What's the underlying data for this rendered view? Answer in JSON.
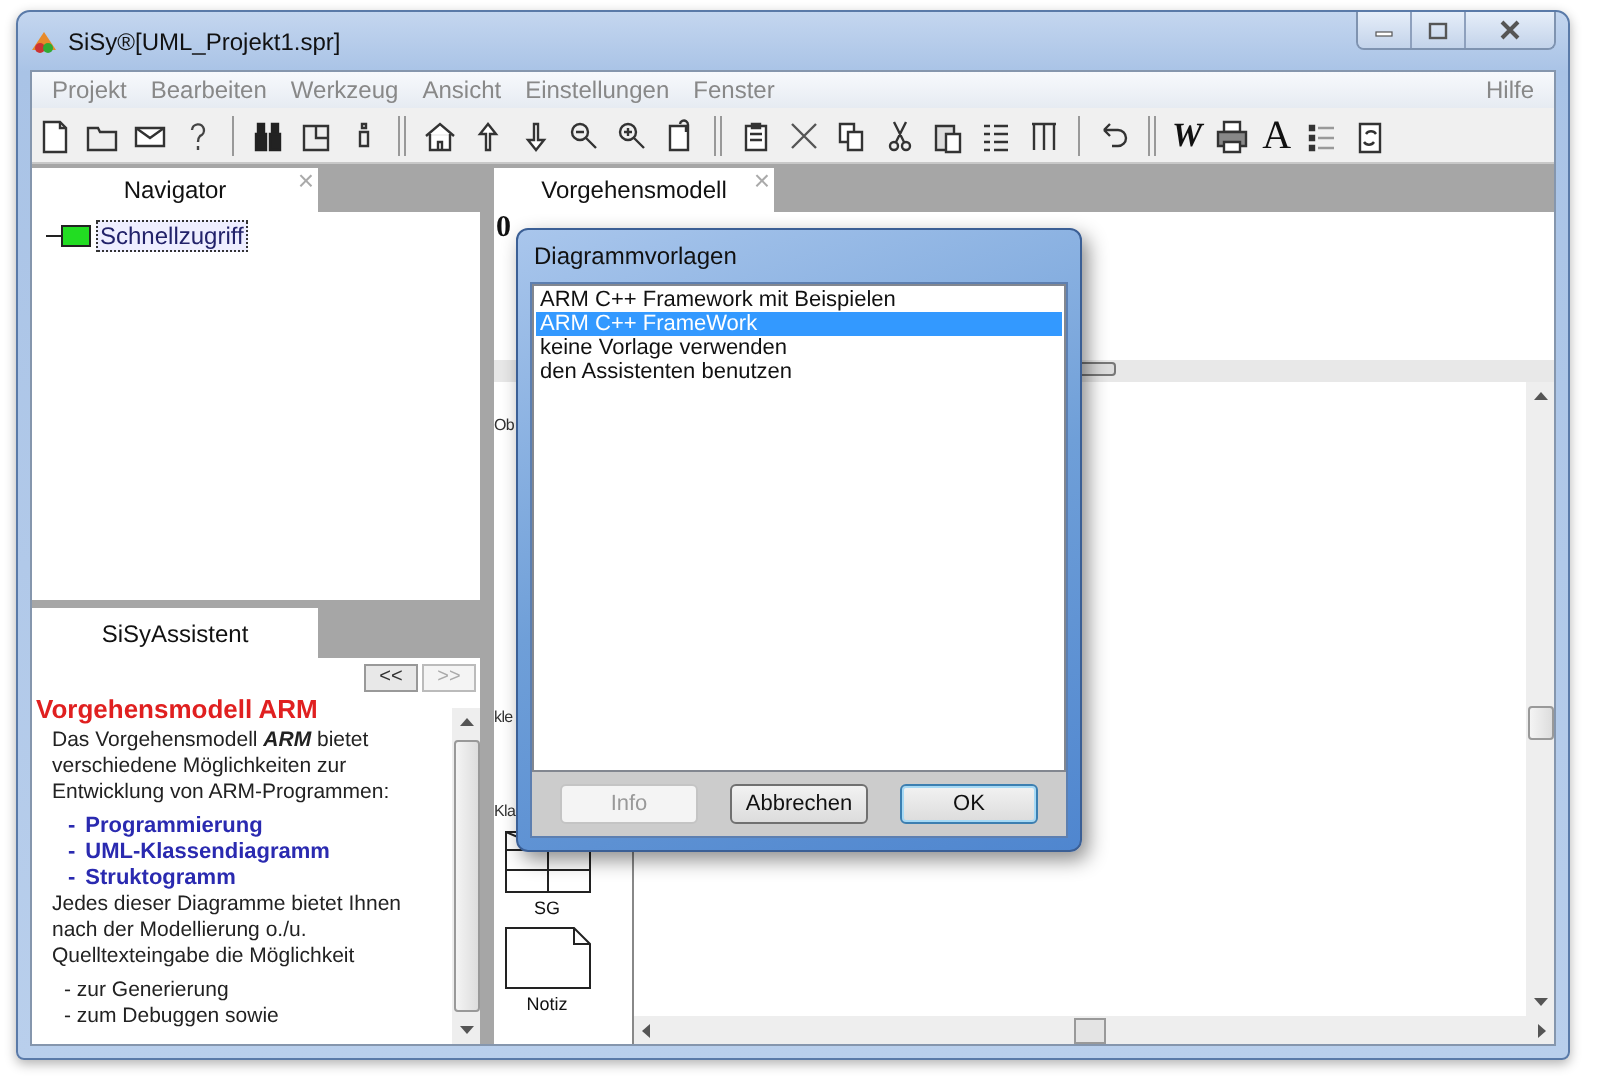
{
  "window": {
    "title": "SiSy®[UML_Projekt1.spr]"
  },
  "menu": {
    "items": [
      "Projekt",
      "Bearbeiten",
      "Werkzeug",
      "Ansicht",
      "Einstellungen",
      "Fenster"
    ],
    "help": "Hilfe"
  },
  "toolbar": {
    "word_glyph": "W",
    "font_glyph": "A"
  },
  "navigator": {
    "tab": "Navigator",
    "close": "×",
    "items": [
      {
        "label": "Schnellzugriff",
        "selected": true
      }
    ]
  },
  "assistant": {
    "tab": "SiSyAssistent",
    "back": "<<",
    "forward": ">>",
    "forward_disabled": true,
    "heading": "Vorgehensmodell ARM",
    "intro": "Das Vorgehensmodell **ARM** bietet verschiedene Möglichkeiten zur Entwicklung von ARM-Programmen:",
    "links": [
      {
        "dash": "-",
        "text": "Programmierung"
      },
      {
        "dash": "-",
        "text": "UML-Klassendiagramm"
      },
      {
        "dash": "-",
        "text": "Struktogramm"
      }
    ],
    "body": "Jedes dieser Diagramme bietet Ihnen nach der Modellierung o./u. Quelltexteingabe die Möglichkeit",
    "steps": [
      "- zur Generierung",
      "- zum Debuggen sowie"
    ]
  },
  "editor": {
    "tab": "Vorgehensmodell",
    "close": "×",
    "corner_text": "0",
    "palette": {
      "label_1": "Ob",
      "label_2": "kle",
      "label_3": "Kla",
      "items": [
        {
          "kind": "table",
          "label": "SG"
        },
        {
          "kind": "note",
          "label": "Notiz"
        }
      ]
    }
  },
  "dialog": {
    "title": "Diagrammvorlagen",
    "items": [
      {
        "label": "ARM C++ Framework mit Beispielen",
        "selected": false
      },
      {
        "label": "ARM C++ FrameWork",
        "selected": true
      },
      {
        "label": "keine Vorlage verwenden",
        "selected": false
      },
      {
        "label": "den Assistenten benutzen",
        "selected": false
      }
    ],
    "buttons": [
      {
        "label": "Info",
        "disabled": true,
        "default": false
      },
      {
        "label": "Abbrechen",
        "disabled": false,
        "default": false
      },
      {
        "label": "OK",
        "disabled": false,
        "default": true
      }
    ]
  }
}
